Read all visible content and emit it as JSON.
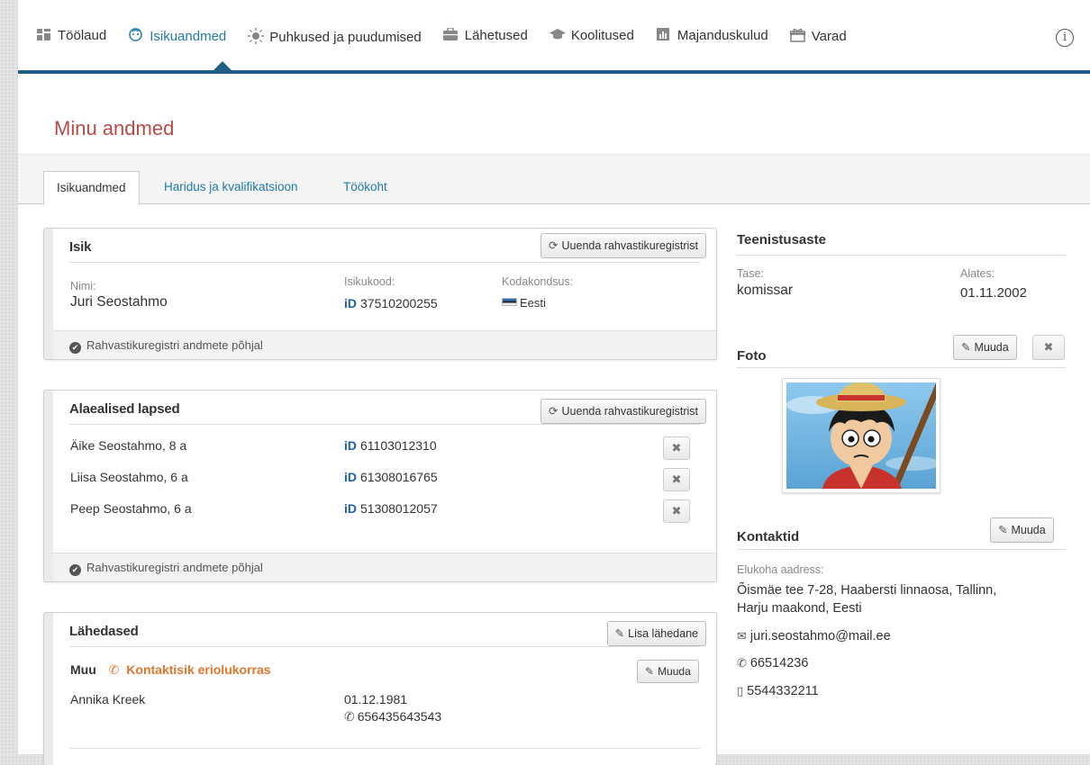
{
  "nav": {
    "items": [
      {
        "label": "Töölaud",
        "icon": "dashboard-icon"
      },
      {
        "label": "Isikuandmed",
        "icon": "person-face-icon"
      },
      {
        "label": "Puhkused ja puudumised",
        "icon": "sun-icon"
      },
      {
        "label": "Lähetused",
        "icon": "briefcase-icon"
      },
      {
        "label": "Koolitused",
        "icon": "graduation-cap-icon"
      },
      {
        "label": "Majanduskulud",
        "icon": "bar-chart-icon"
      },
      {
        "label": "Varad",
        "icon": "gift-box-icon"
      }
    ],
    "active": "Isikuandmed",
    "info_icon": "info-icon"
  },
  "page": {
    "title": "Minu andmed"
  },
  "tabs": [
    {
      "label": "Isikuandmed",
      "active": true
    },
    {
      "label": "Haridus ja kvalifikatsioon",
      "active": false
    },
    {
      "label": "Töökoht",
      "active": false
    }
  ],
  "isik": {
    "title": "Isik",
    "refresh_button": "Uuenda rahvastikuregistrist",
    "name_label": "Nimi:",
    "name_value": "Juri Seostahmo",
    "code_label": "Isikukood:",
    "code_value": "37510200255",
    "citizenship_label": "Kodakondsus:",
    "citizenship_value": "Eesti",
    "footer": "Rahvastikuregistri andmete põhjal"
  },
  "children": {
    "title": "Alaealised lapsed",
    "refresh_button": "Uuenda rahvastikuregistrist",
    "rows": [
      {
        "name": "Äike Seostahmo, 8 a",
        "code": "61103012310"
      },
      {
        "name": "Liisa Seostahmo, 6 a",
        "code": "61308016765"
      },
      {
        "name": "Peep Seostahmo, 6 a",
        "code": "51308012057"
      }
    ],
    "remove_symbol": "✖",
    "footer": "Rahvastikuregistri andmete põhjal"
  },
  "relatives": {
    "title": "Lähedased",
    "add_button": "Lisa lähedane",
    "type_label": "Muu",
    "emergency_label": "Kontaktisik eriolukorras",
    "edit_button": "Muuda",
    "person_name": "Annika Kreek",
    "person_birthdate": "01.12.1981",
    "person_phone": "656435643543"
  },
  "rank": {
    "title": "Teenistusaste",
    "level_label": "Tase:",
    "level_value": "komissar",
    "since_label": "Alates:",
    "since_value": "01.11.2002"
  },
  "photo": {
    "title": "Foto",
    "edit_button": "Muuda",
    "remove_symbol": "✖"
  },
  "contacts": {
    "title": "Kontaktid",
    "edit_button": "Muuda",
    "address_label": "Elukoha aadress:",
    "address_line1": "Õismäe tee 7-28, Haabersti linnaosa, Tallinn,",
    "address_line2": "Harju maakond, Eesti",
    "email": "juri.seostahmo@mail.ee",
    "phone": "66514236",
    "mobile": "5544332211"
  },
  "id_mark": "iD",
  "colors": {
    "accent": "#1f7aa8",
    "nav_bar": "#1f5f86",
    "title_red": "#b94a48",
    "id_blue": "#1a5fb4",
    "emergency_orange": "#e0762b"
  }
}
